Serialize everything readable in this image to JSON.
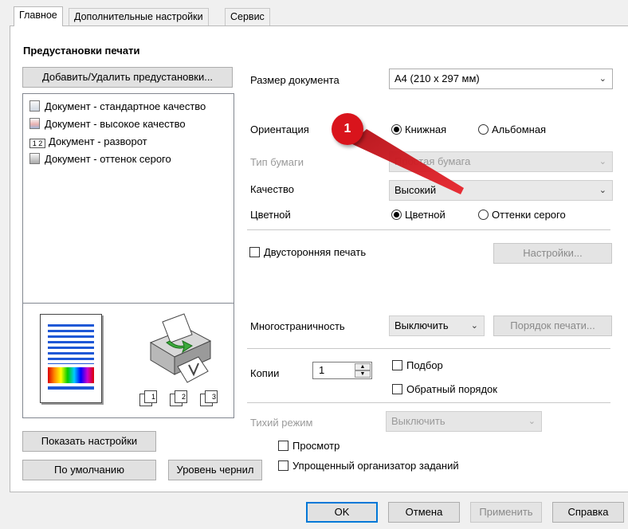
{
  "tabs": [
    {
      "label": "Главное"
    },
    {
      "label": "Дополнительные настройки"
    },
    {
      "label": "Сервис"
    }
  ],
  "presets": {
    "title": "Предустановки печати",
    "add_remove_button": "Добавить/Удалить предустановки...",
    "items": [
      {
        "label": "Документ - стандартное качество"
      },
      {
        "label": "Документ - высокое качество"
      },
      {
        "label": "Документ - разворот",
        "icon_text": "1 2"
      },
      {
        "label": "Документ - оттенок серого"
      }
    ]
  },
  "preview": {
    "copy_icons": [
      "1",
      "2",
      "3"
    ]
  },
  "settings": {
    "doc_size_label": "Размер документа",
    "doc_size_value": "A4 (210 x 297 мм)",
    "orientation_label": "Ориентация",
    "orientation_portrait": "Книжная",
    "orientation_landscape": "Альбомная",
    "paper_type_label": "Тип бумаги",
    "paper_type_value": "Простая бумага",
    "quality_label": "Качество",
    "quality_value": "Высокий",
    "color_label": "Цветной",
    "color_color": "Цветной",
    "color_gray": "Оттенки серого",
    "duplex_label": "Двусторонняя печать",
    "duplex_settings_button": "Настройки...",
    "multipage_label": "Многостраничность",
    "multipage_value": "Выключить",
    "print_order_button": "Порядок печати...",
    "copies_label": "Копии",
    "copies_value": "1",
    "collate_label": "Подбор",
    "reverse_label": "Обратный порядок",
    "quiet_label": "Тихий режим",
    "quiet_value": "Выключить",
    "preview_label": "Просмотр",
    "job_arranger_label": "Упрощенный организатор заданий"
  },
  "bottom": {
    "show_settings_button": "Показать настройки",
    "defaults_button": "По умолчанию",
    "ink_level_button": "Уровень чернил"
  },
  "dialog": {
    "ok_button": "OK",
    "cancel_button": "Отмена",
    "apply_button": "Применить",
    "help_button": "Справка"
  },
  "annotation": {
    "number": "1",
    "color": "#d9141c"
  }
}
